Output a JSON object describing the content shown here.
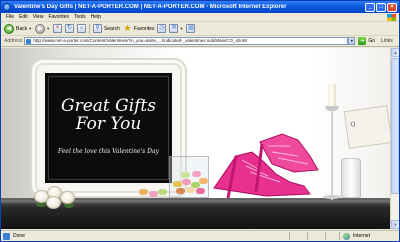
{
  "window": {
    "title": "Valentine's Day Gifts | NET-A-PORTER.COM | NET-A-PORTER.COM - Microsoft Internet Explorer",
    "controls": [
      "_",
      "□",
      "×"
    ]
  },
  "menu": [
    "File",
    "Edit",
    "View",
    "Favorites",
    "Tools",
    "Help"
  ],
  "toolbar": {
    "back_label": "Back",
    "search_label": "Search",
    "favorites_label": "Favorites"
  },
  "address": {
    "label": "Address",
    "url": "http://www.net-a-porter.com/Content/Valentines/Yo_you=&site_...lindicated-_valentines.sub/Main/CO_shoW",
    "go_label": "Go",
    "links_label": "Links"
  },
  "banner": {
    "headline_line1": "Great Gifts",
    "headline_line2": "For You",
    "tagline": "Feel the love this Valentine's Day",
    "card_text": "Q"
  },
  "status": {
    "text": "Done",
    "zone": "Internet"
  },
  "colors": {
    "titlebar": "#0a57e0",
    "chrome": "#ece9d8",
    "sign_background": "#0c0c0c",
    "shoe_pink": "#e0278a"
  }
}
